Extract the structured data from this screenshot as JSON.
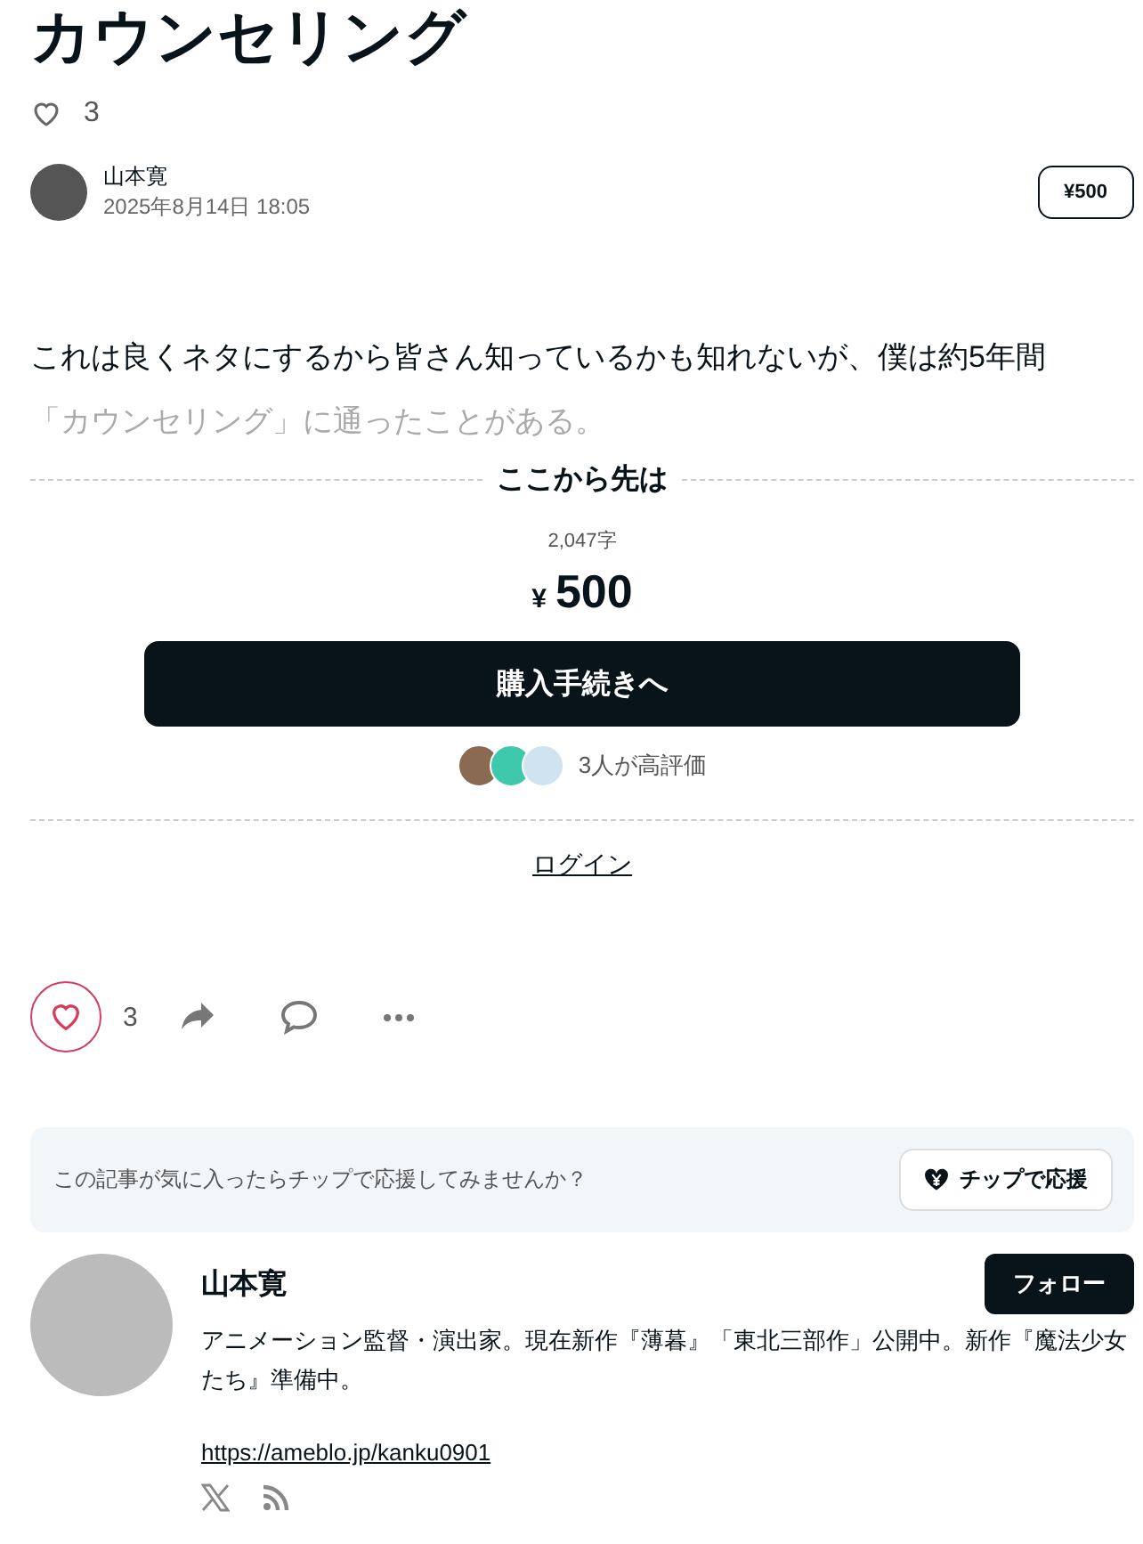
{
  "title": "カウンセリング",
  "like_count": "3",
  "author": {
    "name": "山本寛",
    "date": "2025年8月14日 18:05",
    "price_badge": "¥500"
  },
  "body": {
    "text": "これは良くネタにするから皆さん知っているかも知れないが、僕は約5年間",
    "faded_text": "「カウンセリング」に通ったことがある。"
  },
  "paywall": {
    "heading": "ここから先は",
    "char_count": "2,047字",
    "currency": "¥",
    "price": "500",
    "buy_button": "購入手続きへ",
    "raters": "3人が高評価",
    "login": "ログイン"
  },
  "actions": {
    "like_count": "3"
  },
  "tip": {
    "prompt": "この記事が気に入ったらチップで応援してみませんか？",
    "button": "チップで応援"
  },
  "profile": {
    "name": "山本寛",
    "follow_button": "フォロー",
    "bio": "アニメーション監督・演出家。現在新作『薄暮』「東北三部作」公開中。新作『魔法少女たち』準備中。",
    "link": "https://ameblo.jp/kanku0901"
  }
}
